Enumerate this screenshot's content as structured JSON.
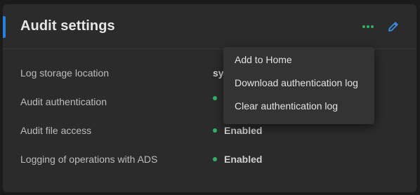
{
  "card": {
    "title": "Audit settings"
  },
  "header_actions": {
    "more_icon": "more-horizontal-icon",
    "edit_icon": "pencil-icon"
  },
  "rows": [
    {
      "label": "Log storage location",
      "value": "sy",
      "has_status_dot": false
    },
    {
      "label": "Audit authentication",
      "value": "",
      "has_status_dot": true
    },
    {
      "label": "Audit file access",
      "value": "Enabled",
      "has_status_dot": true
    },
    {
      "label": "Logging of operations with ADS",
      "value": "Enabled",
      "has_status_dot": true
    }
  ],
  "menu": {
    "items": [
      {
        "label": "Add to Home"
      },
      {
        "label": "Download authentication log"
      },
      {
        "label": "Clear authentication log"
      }
    ]
  },
  "colors": {
    "accent": "#2a7fdc",
    "status_ok": "#2fb362",
    "more_icon": "#2fb362",
    "edit_icon": "#3b8ee6"
  }
}
